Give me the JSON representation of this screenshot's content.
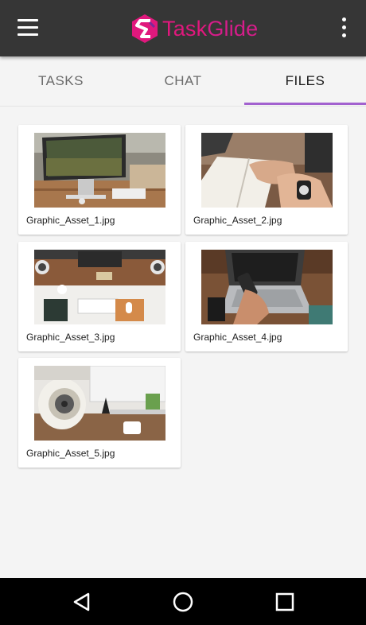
{
  "app": {
    "logo_text_a": "Task",
    "logo_text_b": "Glide",
    "brand_color": "#e0187d",
    "accent_color": "#a261cf"
  },
  "appbar": {
    "menu_icon": "hamburger-menu-icon",
    "overflow_icon": "more-vertical-icon"
  },
  "tabs": [
    {
      "label": "TASKS",
      "active": false
    },
    {
      "label": "CHAT",
      "active": false
    },
    {
      "label": "FILES",
      "active": true
    }
  ],
  "files": [
    {
      "name": "Graphic_Asset_1.jpg",
      "thumbnail": "desk-imac-photo"
    },
    {
      "name": "Graphic_Asset_2.jpg",
      "thumbnail": "hands-notebook-photo"
    },
    {
      "name": "Graphic_Asset_3.jpg",
      "thumbnail": "workspace-topdown-photo"
    },
    {
      "name": "Graphic_Asset_4.jpg",
      "thumbnail": "phone-laptop-photo"
    },
    {
      "name": "Graphic_Asset_5.jpg",
      "thumbnail": "speaker-desk-photo"
    }
  ],
  "navbar": {
    "back_icon": "back-triangle-icon",
    "home_icon": "home-circle-icon",
    "recents_icon": "recents-square-icon"
  }
}
